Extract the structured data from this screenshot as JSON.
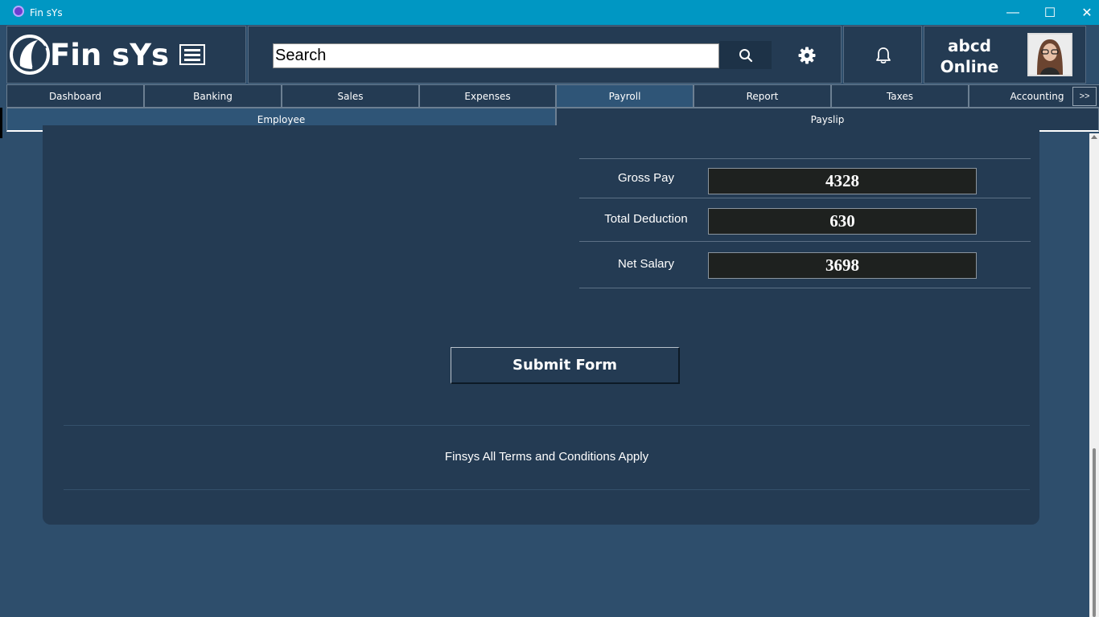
{
  "window": {
    "title": "Fin sYs",
    "minimize_glyph": "—",
    "maximize_glyph": "☐",
    "close_glyph": "✕"
  },
  "header": {
    "logo_text": "Fin sYs",
    "search": {
      "value": "Search",
      "placeholder": ""
    },
    "user": {
      "name": "abcd",
      "status": "Online"
    }
  },
  "tabs": [
    {
      "label": "Dashboard",
      "active": false
    },
    {
      "label": "Banking",
      "active": false
    },
    {
      "label": "Sales",
      "active": false
    },
    {
      "label": "Expenses",
      "active": false
    },
    {
      "label": "Payroll",
      "active": true
    },
    {
      "label": "Report",
      "active": false
    },
    {
      "label": "Taxes",
      "active": false
    },
    {
      "label": "Accounting",
      "active": false
    }
  ],
  "tabs_more_label": ">>",
  "subtabs": [
    {
      "label": "Employee",
      "active": true
    },
    {
      "label": "Payslip",
      "active": false
    }
  ],
  "summary": {
    "gross_pay": {
      "label": "Gross Pay",
      "value": "4328"
    },
    "total_deduction": {
      "label": "Total Deduction",
      "value": "630"
    },
    "net_salary": {
      "label": "Net Salary",
      "value": "3698"
    }
  },
  "submit_label": "Submit Form",
  "footer_text": "Finsys All Terms and Conditions Apply",
  "colors": {
    "titlebar": "#0097c3",
    "panel": "#243b53",
    "background": "#2e4e6c",
    "value_box": "#1e211f"
  },
  "icons": [
    "app-icon",
    "logo-icon",
    "menu-icon",
    "search-icon",
    "gear-icon",
    "bell-icon",
    "avatar"
  ]
}
